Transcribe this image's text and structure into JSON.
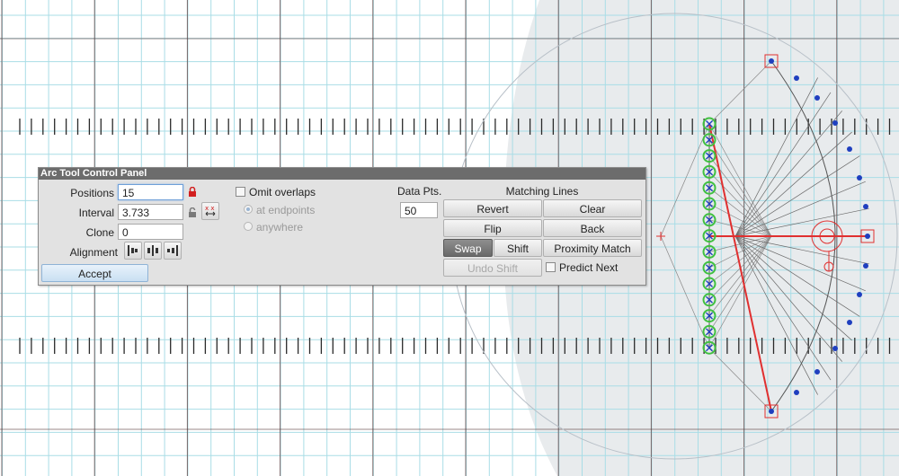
{
  "canvas": {
    "grid_color": "#a9dde6",
    "major_line_color": "#5a3a3a",
    "shade_color": "#e8ebed",
    "accent_red": "#e03030",
    "point_blue": "#1f3fbf",
    "point_green": "#40c040"
  },
  "panel": {
    "title": "Arc Tool Control Panel",
    "positions_label": "Positions",
    "positions_value": "15",
    "interval_label": "Interval",
    "interval_value": "3.733",
    "clone_label": "Clone",
    "clone_value": "0",
    "alignment_label": "Alignment",
    "accept_label": "Accept",
    "omit_overlaps_label": "Omit overlaps",
    "at_endpoints_label": "at endpoints",
    "anywhere_label": "anywhere",
    "data_pts_label": "Data Pts.",
    "data_pts_value": "50",
    "matching_lines_label": "Matching Lines",
    "revert_label": "Revert",
    "clear_label": "Clear",
    "flip_label": "Flip",
    "back_label": "Back",
    "swap_label": "Swap",
    "shift_label": "Shift",
    "proximity_match_label": "Proximity Match",
    "undo_shift_label": "Undo Shift",
    "predict_next_label": "Predict Next",
    "icons": {
      "lock_closed": "lock-closed-icon",
      "lock_open": "lock-open-icon",
      "swap_xx": "xx-arrows-icon",
      "align_left": "align-left-icon",
      "align_center": "align-center-icon",
      "align_right": "align-right-icon"
    }
  }
}
